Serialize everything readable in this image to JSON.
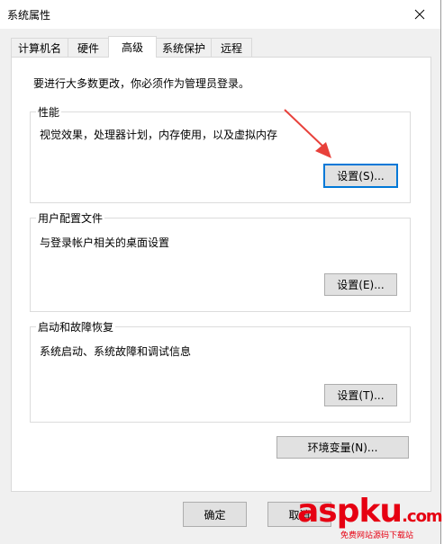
{
  "window": {
    "title": "系统属性"
  },
  "tabs": [
    {
      "label": "计算机名"
    },
    {
      "label": "硬件"
    },
    {
      "label": "高级"
    },
    {
      "label": "系统保护"
    },
    {
      "label": "远程"
    }
  ],
  "admin_note": "要进行大多数更改，你必须作为管理员登录。",
  "performance": {
    "title": "性能",
    "desc": "视觉效果，处理器计划，内存使用，以及虚拟内存",
    "button": "设置(S)..."
  },
  "profile": {
    "title": "用户配置文件",
    "desc": "与登录帐户相关的桌面设置",
    "button": "设置(E)..."
  },
  "startup": {
    "title": "启动和故障恢复",
    "desc": "系统启动、系统故障和调试信息",
    "button": "设置(T)..."
  },
  "env_button": "环境变量(N)...",
  "footer": {
    "ok": "确定",
    "cancel": "取消"
  },
  "watermark": {
    "logo": "aspku",
    "suffix": ".com",
    "sub": "免费网站源码下载站"
  },
  "colors": {
    "arrow": "#e8413b",
    "focus_border": "#0078d7",
    "watermark": "#e60012"
  }
}
